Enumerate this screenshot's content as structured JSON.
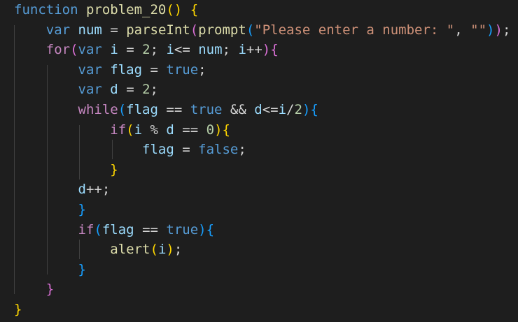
{
  "editor": {
    "language": "javascript",
    "theme_colors": {
      "background": "#1e1e1e",
      "keyword": "#569cd6",
      "control": "#c586c0",
      "function": "#dcdcaa",
      "variable": "#9cdcfe",
      "string": "#ce9178",
      "number": "#b5cea8",
      "text": "#d4d4d4",
      "bracket_level_1": "#ffd700",
      "bracket_level_2": "#da70d6",
      "bracket_level_3": "#179fff"
    },
    "lines": [
      [
        [
          "kw",
          "function"
        ],
        [
          "op",
          " "
        ],
        [
          "fn",
          "problem_20"
        ],
        [
          "b1",
          "()"
        ],
        [
          "op",
          " "
        ],
        [
          "b1",
          "{"
        ]
      ],
      [
        [
          "op",
          "    "
        ],
        [
          "kw",
          "var"
        ],
        [
          "op",
          " "
        ],
        [
          "var",
          "num"
        ],
        [
          "op",
          " = "
        ],
        [
          "fn",
          "parseInt"
        ],
        [
          "b2",
          "("
        ],
        [
          "fn",
          "prompt"
        ],
        [
          "b3",
          "("
        ],
        [
          "str",
          "\"Please enter a number: \""
        ],
        [
          "op",
          ", "
        ],
        [
          "str",
          "\"\""
        ],
        [
          "b3",
          ")"
        ],
        [
          "b2",
          ")"
        ],
        [
          "op",
          ";"
        ]
      ],
      [
        [
          "op",
          "    "
        ],
        [
          "ctl",
          "for"
        ],
        [
          "b2",
          "("
        ],
        [
          "kw",
          "var"
        ],
        [
          "op",
          " "
        ],
        [
          "var",
          "i"
        ],
        [
          "op",
          " = "
        ],
        [
          "num",
          "2"
        ],
        [
          "op",
          "; "
        ],
        [
          "var",
          "i"
        ],
        [
          "op",
          "<= "
        ],
        [
          "var",
          "num"
        ],
        [
          "op",
          "; "
        ],
        [
          "var",
          "i"
        ],
        [
          "op",
          "++"
        ],
        [
          "b2",
          ")"
        ],
        [
          "b2",
          "{"
        ]
      ],
      [
        [
          "op",
          "        "
        ],
        [
          "kw",
          "var"
        ],
        [
          "op",
          " "
        ],
        [
          "var",
          "flag"
        ],
        [
          "op",
          " = "
        ],
        [
          "kw",
          "true"
        ],
        [
          "op",
          ";"
        ]
      ],
      [
        [
          "op",
          "        "
        ],
        [
          "kw",
          "var"
        ],
        [
          "op",
          " "
        ],
        [
          "var",
          "d"
        ],
        [
          "op",
          " = "
        ],
        [
          "num",
          "2"
        ],
        [
          "op",
          ";"
        ]
      ],
      [
        [
          "op",
          "        "
        ],
        [
          "ctl",
          "while"
        ],
        [
          "b3",
          "("
        ],
        [
          "var",
          "flag"
        ],
        [
          "op",
          " == "
        ],
        [
          "kw",
          "true"
        ],
        [
          "op",
          " && "
        ],
        [
          "var",
          "d"
        ],
        [
          "op",
          "<="
        ],
        [
          "var",
          "i"
        ],
        [
          "op",
          "/"
        ],
        [
          "num",
          "2"
        ],
        [
          "b3",
          ")"
        ],
        [
          "b3",
          "{"
        ]
      ],
      [
        [
          "op",
          "            "
        ],
        [
          "ctl",
          "if"
        ],
        [
          "b1",
          "("
        ],
        [
          "var",
          "i"
        ],
        [
          "op",
          " % "
        ],
        [
          "var",
          "d"
        ],
        [
          "op",
          " == "
        ],
        [
          "num",
          "0"
        ],
        [
          "b1",
          ")"
        ],
        [
          "b1",
          "{"
        ]
      ],
      [
        [
          "op",
          "                "
        ],
        [
          "var",
          "flag"
        ],
        [
          "op",
          " = "
        ],
        [
          "kw",
          "false"
        ],
        [
          "op",
          ";"
        ]
      ],
      [
        [
          "op",
          "            "
        ],
        [
          "b1",
          "}"
        ]
      ],
      [
        [
          "op",
          "        "
        ],
        [
          "var",
          "d"
        ],
        [
          "op",
          "++;"
        ]
      ],
      [
        [
          "op",
          "        "
        ],
        [
          "b3",
          "}"
        ]
      ],
      [
        [
          "op",
          "        "
        ],
        [
          "ctl",
          "if"
        ],
        [
          "b3",
          "("
        ],
        [
          "var",
          "flag"
        ],
        [
          "op",
          " == "
        ],
        [
          "kw",
          "true"
        ],
        [
          "b3",
          ")"
        ],
        [
          "b3",
          "{"
        ]
      ],
      [
        [
          "op",
          "            "
        ],
        [
          "fn",
          "alert"
        ],
        [
          "b1",
          "("
        ],
        [
          "var",
          "i"
        ],
        [
          "b1",
          ")"
        ],
        [
          "op",
          ";"
        ]
      ],
      [
        [
          "op",
          "        "
        ],
        [
          "b3",
          "}"
        ]
      ],
      [
        [
          "op",
          "    "
        ],
        [
          "b2",
          "}"
        ]
      ],
      [
        [
          "b1",
          "}"
        ]
      ]
    ]
  }
}
